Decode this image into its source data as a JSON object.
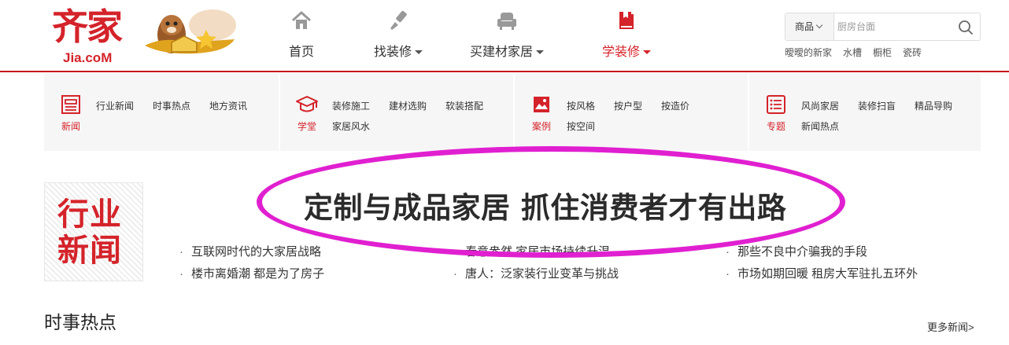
{
  "logo": {
    "cn": "齐家",
    "en": "Jia.coM"
  },
  "nav": [
    {
      "label": "首页",
      "icon": "home-icon",
      "dropdown": false,
      "active": false
    },
    {
      "label": "找装修",
      "icon": "brush-icon",
      "dropdown": true,
      "active": false
    },
    {
      "label": "买建材家居",
      "icon": "sofa-icon",
      "dropdown": true,
      "active": false
    },
    {
      "label": "学装修",
      "icon": "book-icon",
      "dropdown": true,
      "active": true
    }
  ],
  "search": {
    "category": "商品",
    "placeholder": "厨房台面",
    "hotwords": [
      "曖曖的新家",
      "水槽",
      "橱柜",
      "瓷砖"
    ]
  },
  "categories": [
    {
      "name": "新闻",
      "icon": "news-icon",
      "links": [
        "行业新闻",
        "时事热点",
        "地方资讯"
      ]
    },
    {
      "name": "学堂",
      "icon": "graduation-cap-icon",
      "links": [
        "装修施工",
        "建材选购",
        "软装搭配",
        "家居风水"
      ]
    },
    {
      "name": "案例",
      "icon": "picture-icon",
      "links": [
        "按风格",
        "按户型",
        "按造价",
        "按空间"
      ]
    },
    {
      "name": "专题",
      "icon": "list-icon",
      "links": [
        "风尚家居",
        "装修扫盲",
        "精品导购",
        "新闻热点"
      ]
    }
  ],
  "industry_news": {
    "badge_line1": "行业",
    "badge_line2": "新闻",
    "headline": "定制与成品家居 抓住消费者才有出路",
    "items": [
      "互联网时代的大家居战略",
      "春意盎然 家居市场持续升温",
      "那些不良中介骗我的手段",
      "楼市离婚潮 都是为了房子",
      "唐人：泛家装行业变革与挑战",
      "市场如期回暖 租房大军驻扎五环外"
    ]
  },
  "current_affairs": {
    "title": "时事热点",
    "more": "更多新闻>"
  },
  "colors": {
    "brand_red": "#d4232a",
    "highlight_ellipse": "#e020d0",
    "panel_bg": "#f6f6f6"
  }
}
